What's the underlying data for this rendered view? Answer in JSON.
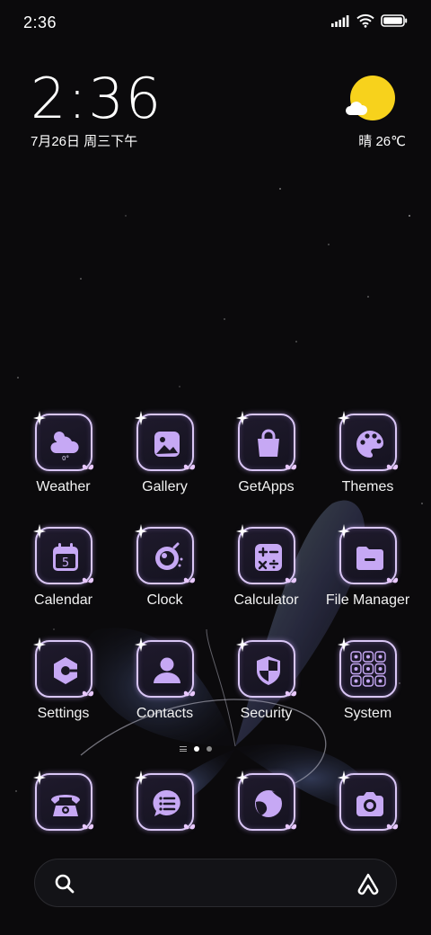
{
  "status_bar": {
    "time": "2:36"
  },
  "clock_widget": {
    "time": "2:36",
    "date": "7月26日 周三下午"
  },
  "weather_widget": {
    "temperature": "晴 26℃"
  },
  "apps": [
    {
      "name": "weather",
      "label": "Weather",
      "icon": "weather-icon",
      "badge": "0°"
    },
    {
      "name": "gallery",
      "label": "Gallery",
      "icon": "gallery-icon"
    },
    {
      "name": "getapps",
      "label": "GetApps",
      "icon": "shopping-bag-icon"
    },
    {
      "name": "themes",
      "label": "Themes",
      "icon": "palette-icon"
    },
    {
      "name": "calendar",
      "label": "Calendar",
      "icon": "calendar-icon",
      "badge": "5"
    },
    {
      "name": "clock",
      "label": "Clock",
      "icon": "clock-icon"
    },
    {
      "name": "calculator",
      "label": "Calculator",
      "icon": "calculator-icon"
    },
    {
      "name": "file-manager",
      "label": "File Manager",
      "icon": "folder-icon"
    },
    {
      "name": "settings",
      "label": "Settings",
      "icon": "gear-icon"
    },
    {
      "name": "contacts",
      "label": "Contacts",
      "icon": "person-icon"
    },
    {
      "name": "security",
      "label": "Security",
      "icon": "shield-icon"
    },
    {
      "name": "system",
      "label": "System",
      "icon": "folder-grid-icon"
    }
  ],
  "dock": [
    {
      "name": "phone",
      "icon": "phone-icon"
    },
    {
      "name": "messages",
      "icon": "message-icon"
    },
    {
      "name": "browser",
      "icon": "globe-icon"
    },
    {
      "name": "camera",
      "icon": "camera-icon"
    }
  ],
  "pages": {
    "count": 2,
    "current": 1
  },
  "colors": {
    "tile_border": "#d9c6f5",
    "glyph": "#c6a8f4",
    "sun": "#f7d21c"
  }
}
